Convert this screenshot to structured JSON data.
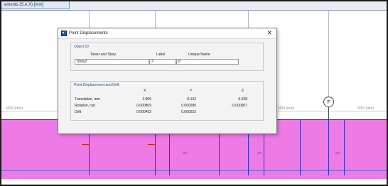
{
  "tab": {
    "label": "ements (S.e.X) [mm]"
  },
  "plan": {
    "dim_left": "6300 (mm)",
    "dim_mid": "7450 (mm)",
    "dim_right": "7450 (mm)",
    "grid_bubble": "F"
  },
  "dialog": {
    "title": "Point Displacements",
    "object_id": {
      "group_title": "Object ID",
      "col_tower_story": "Tower and Story",
      "col_label": "Label",
      "col_unique_name": "Unique Name",
      "story_value": "Story2",
      "label_value": "3",
      "unique_name_value": "8"
    },
    "disp": {
      "group_title": "Point Displacement and Drift",
      "col_x": "X",
      "col_y": "Y",
      "col_z": "Z",
      "rows": [
        {
          "label": "Translation, mm",
          "x": "2.806",
          "y": "-0.132",
          "z": "-0.028"
        },
        {
          "label": "Rotation, rad",
          "x": "0.000809",
          "y": "0.000280",
          "z": "-0.000007"
        },
        {
          "label": "Drift",
          "x": "0.000452",
          "y": "0.000023",
          "z": ""
        }
      ]
    }
  },
  "colors": {
    "slab": "#ee7ae6",
    "beam": "#3333cc",
    "group_title": "#1f4fb0"
  }
}
